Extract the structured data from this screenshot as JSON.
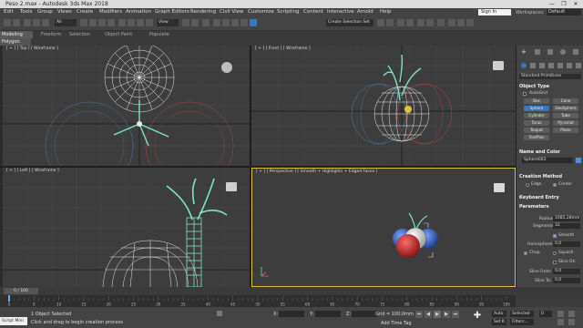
{
  "title": "Peso 2.max - Autodesk 3ds Max 2018",
  "window_controls": [
    "—",
    "❐",
    "✕"
  ],
  "menu": [
    "Edit",
    "Tools",
    "Group",
    "Views",
    "Create",
    "Modifiers",
    "Animation",
    "Graph Editors",
    "Rendering",
    "Civil View",
    "Customize",
    "Scripting",
    "Content",
    "Interactive",
    "Arnold",
    "Help"
  ],
  "account": {
    "sign_in": "Sign In",
    "workspaces_label": "Workspaces:",
    "workspace": "Default"
  },
  "toolbar": {
    "selection_filter": "All",
    "ref_coord": "View",
    "named_selection": "Create Selection Set"
  },
  "ribbon": {
    "active": "Modeling",
    "tabs": [
      "Freeform",
      "Selection",
      "Object Paint",
      "Populate"
    ],
    "sub": "Polygon Modeling"
  },
  "viewports": {
    "top_left": "[ + ] [ Top ] [ Wireframe ]",
    "top_right": "[ + ] [ Front ] [ Wireframe ]",
    "bottom_left": "[ + ] [ Left ] [ Wireframe ]",
    "bottom_right": "[ + ] [ Perspective ] [ Smooth + Highlights + Edged Faces ]"
  },
  "command_panel": {
    "category": "Standard Primitives",
    "object_type": {
      "header": "Object Type",
      "autogrid": "AutoGrid",
      "buttons": [
        "Box",
        "Cone",
        "Sphere",
        "GeoSphere",
        "Cylinder",
        "Tube",
        "Torus",
        "Pyramid",
        "Teapot",
        "Plane",
        "TextPlus"
      ],
      "selected": "Sphere"
    },
    "name_color": {
      "header": "Name and Color",
      "name": "Sphere003"
    },
    "creation_method": {
      "header": "Creation Method",
      "options": [
        "Edge",
        "Center"
      ],
      "selected": "Center"
    },
    "keyboard_entry": {
      "header": "Keyboard Entry"
    },
    "parameters": {
      "header": "Parameters",
      "radius_label": "Radius:",
      "radius": "1085,28mm",
      "segments_label": "Segments:",
      "segments": "32",
      "smooth": "Smooth",
      "hemisphere_label": "Hemisphere:",
      "hemisphere": "0,0",
      "chop": "Chop",
      "squash": "Squash",
      "slice_on": "Slice On",
      "slice_from_label": "Slice From:",
      "slice_from": "0,0",
      "slice_to_label": "Slice To:",
      "slice_to": "0,0"
    }
  },
  "timeline": {
    "frame": "0 / 100",
    "ticks": [
      "0",
      "5",
      "10",
      "15",
      "20",
      "25",
      "30",
      "35",
      "40",
      "45",
      "50",
      "55",
      "60",
      "65",
      "70",
      "75",
      "80",
      "85",
      "90",
      "95",
      "100"
    ],
    "progress_fraction": 0.0
  },
  "status": {
    "selection": "1 Object Selected",
    "prompt": "Click and drag to begin creation process",
    "script_hint": "Script Mini",
    "x_label": "X:",
    "y_label": "Y:",
    "z_label": "Z:",
    "grid": "Grid = 100,0mm",
    "add_time_tag": "Add Time Tag",
    "auto": "Auto",
    "selected": "Selected",
    "set_k": "Set K.",
    "filters": "Filters...",
    "frame_field": "0"
  },
  "colors": {
    "wire_white": "#e8e8e8",
    "stem_cyan": "#7fe3c4",
    "red_sphere": "#c8282a",
    "blue_sphere": "#3a6bd0",
    "select_blue": "#3d76b8"
  }
}
